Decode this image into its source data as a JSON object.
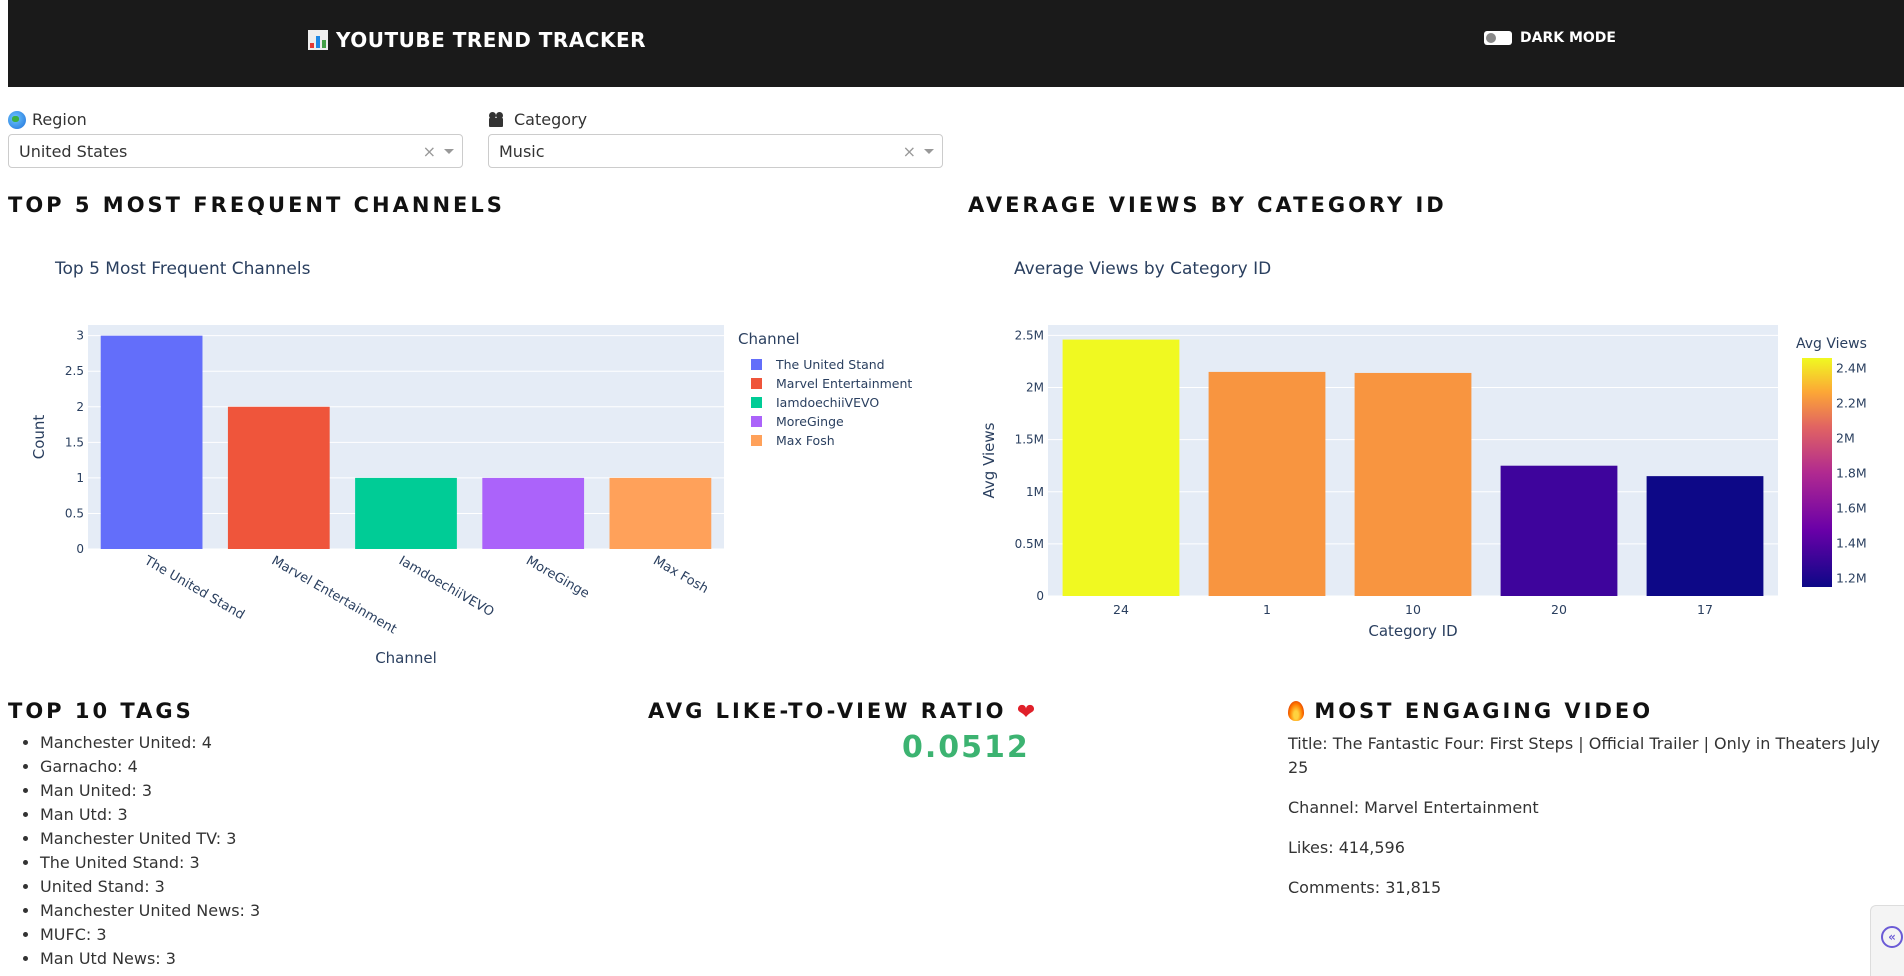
{
  "header": {
    "title": "YOUTUBE TREND TRACKER",
    "title_icon": "bar-chart-emoji",
    "dark_mode_label": "DARK MODE",
    "dark_mode_on": false
  },
  "filters": {
    "region": {
      "label": "Region",
      "icon": "globe-emoji",
      "value": "United States"
    },
    "category": {
      "label": "Category",
      "icon": "movie-camera-emoji",
      "value": "Music"
    }
  },
  "sections": {
    "top_channels": "TOP 5 MOST FREQUENT CHANNELS",
    "avg_views": "AVERAGE VIEWS BY CATEGORY ID",
    "top_tags": "TOP 10 TAGS",
    "ratio": "AVG LIKE-TO-VIEW RATIO",
    "engaging": "MOST ENGAGING VIDEO"
  },
  "chart_data": [
    {
      "type": "bar",
      "title": "Top 5 Most Frequent Channels",
      "xlabel": "Channel",
      "ylabel": "Count",
      "categories": [
        "The United Stand",
        "Marvel Entertainment",
        "IamdoechiiVEVO",
        "MoreGinge",
        "Max Fosh"
      ],
      "values": [
        3,
        2,
        1,
        1,
        1
      ],
      "ylim": [
        0,
        3.15
      ],
      "yticks": [
        "0",
        "0.5",
        "1",
        "1.5",
        "2",
        "2.5",
        "3"
      ],
      "legend_title": "Channel",
      "legend_position": "right",
      "colors": [
        "#636efa",
        "#ef553b",
        "#00cc96",
        "#ab63fa",
        "#ffa15a"
      ],
      "grid": true
    },
    {
      "type": "bar",
      "title": "Average Views by Category ID",
      "xlabel": "Category ID",
      "ylabel": "Avg Views",
      "categories": [
        "24",
        "1",
        "10",
        "20",
        "17"
      ],
      "values": [
        2460000,
        2150000,
        2140000,
        1250000,
        1150000
      ],
      "ylim": [
        0,
        2.6
      ],
      "yticks": [
        "0",
        "0.5M",
        "1M",
        "1.5M",
        "2M",
        "2.5M"
      ],
      "colorbar_title": "Avg Views",
      "colorbar_ticks": [
        "1.2M",
        "1.4M",
        "1.6M",
        "1.8M",
        "2M",
        "2.2M",
        "2.4M"
      ],
      "colorbar_range": [
        1150000,
        2460000
      ],
      "colors": [
        "#f0f921",
        "#f89540",
        "#f89540",
        "#3e049c",
        "#0d0887"
      ],
      "grid": true
    }
  ],
  "top_tags": [
    "Manchester United: 4",
    "Garnacho: 4",
    "Man United: 3",
    "Man Utd: 3",
    "Manchester United TV: 3",
    "The United Stand: 3",
    "United Stand: 3",
    "Manchester United News: 3",
    "MUFC: 3",
    "Man Utd News: 3"
  ],
  "ratio": {
    "value": "0.0512",
    "icon": "red-heart-emoji"
  },
  "engaging": {
    "icon": "fire-emoji",
    "title": "Title: The Fantastic Four: First Steps | Official Trailer | Only in Theaters July 25",
    "channel": "Channel: Marvel Entertainment",
    "likes": "Likes: 414,596",
    "comments": "Comments: 31,815"
  },
  "side_tab_icon": "collapse-left-icon"
}
